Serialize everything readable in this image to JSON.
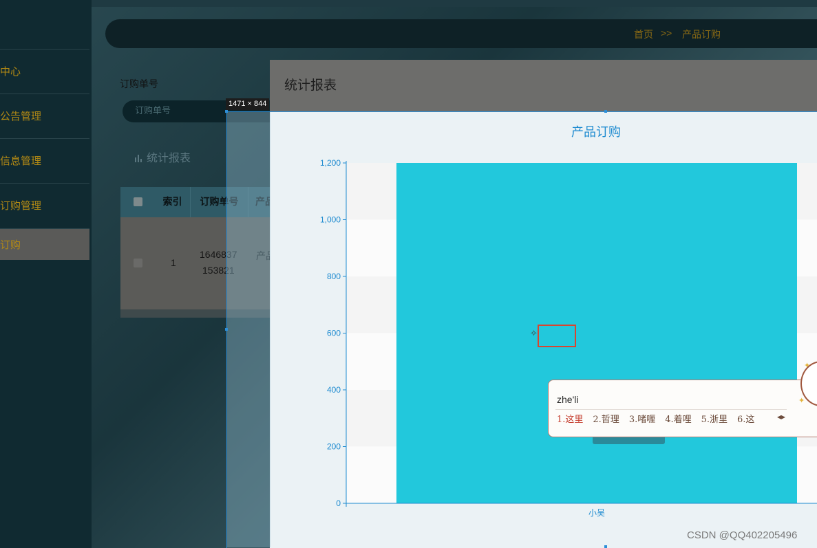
{
  "sidebar": {
    "items": [
      {
        "label": "中心"
      },
      {
        "label": "公告管理"
      },
      {
        "label": "信息管理"
      },
      {
        "label": "订购管理"
      },
      {
        "label": "订购"
      }
    ]
  },
  "breadcrumb": {
    "home": "首页",
    "sep": ">>",
    "current": "产品订购"
  },
  "search": {
    "label": "订购单号",
    "placeholder": "订购单号"
  },
  "toolbar": {
    "stats_label": "统计报表"
  },
  "table": {
    "headers": [
      "索引",
      "订购单号",
      "产品"
    ],
    "rows": [
      {
        "index": "1",
        "order_line1": "1646837",
        "order_line2": "153821",
        "product": "产品"
      }
    ]
  },
  "selection": {
    "size_label": "1471 × 844"
  },
  "modal": {
    "title": "统计报表"
  },
  "chart_data": {
    "type": "bar",
    "title": "产品订购",
    "categories": [
      "小吴"
    ],
    "values": [
      1200
    ],
    "ylim": [
      0,
      1200
    ],
    "yticks": [
      0,
      200,
      400,
      600,
      800,
      1000,
      1200
    ],
    "ytick_labels": [
      "0",
      "200",
      "400",
      "600",
      "800",
      "1,000",
      "1,200"
    ],
    "xlabel": "",
    "ylabel": "",
    "grid": true,
    "bar_color": "#22c8dc",
    "axis_color": "#1e8bd0"
  },
  "ime": {
    "composition": "zhe'li",
    "candidates": [
      "1.这里",
      "2.哲理",
      "3.啫喱",
      "4.着哩",
      "5.浙里",
      "6.这"
    ]
  },
  "watermark": "CSDN @QQ402205496"
}
